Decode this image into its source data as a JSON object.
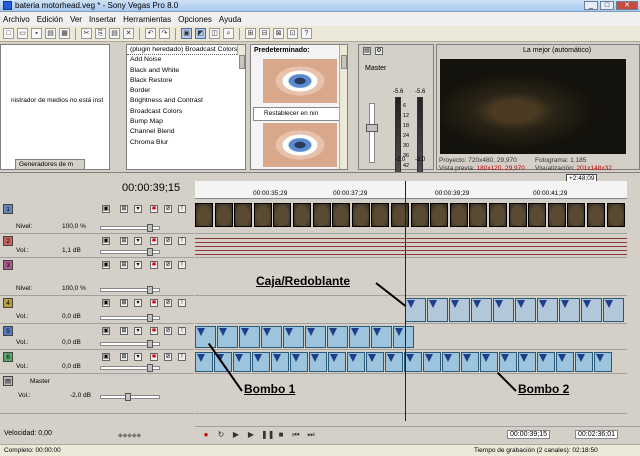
{
  "window": {
    "title": "bateria motorhead.veg * - Sony Vegas Pro 8.0",
    "min": "_",
    "max": "□",
    "close": "✕"
  },
  "menu": [
    "Archivo",
    "Edición",
    "Ver",
    "Insertar",
    "Herramientas",
    "Opciones",
    "Ayuda"
  ],
  "toolbar": {
    "icons": [
      "new-icon",
      "open-icon",
      "save-icon",
      "properties-icon",
      "render-icon",
      "cut-icon",
      "copy-icon",
      "paste-icon",
      "delete-icon",
      "undo-icon",
      "redo-icon",
      "normal-edit-icon",
      "envelope-edit-icon",
      "selection-edit-icon",
      "zoom-edit-icon",
      "snap-icon",
      "autoripple-icon",
      "lock-envelopes-icon",
      "ignore-grouping-icon",
      "help-icon"
    ],
    "glyphs": [
      "□",
      "▭",
      "▪",
      "▤",
      "▦",
      "✂",
      "⎘",
      "▤",
      "✕",
      "↶",
      "↷",
      "▣",
      "◩",
      "◫",
      "⌕",
      "⊞",
      "⊟",
      "⊠",
      "⊡",
      "?"
    ],
    "active": [
      11,
      12
    ]
  },
  "media_explorer": {
    "message": "nistrador de medios no está inst",
    "tab": "Generadores de m"
  },
  "fx_list": {
    "items": [
      "(plugin heredado) Broadcast Colors",
      "Add Noise",
      "Black and White",
      "Black Restore",
      "Border",
      "Brightness and Contrast",
      "Broadcast Colors",
      "Bump Map",
      "Channel Blend",
      "Chroma Blur"
    ],
    "selected": 0
  },
  "presets": {
    "title": "Predeterminado:",
    "reset_label": "Restablecer en nin"
  },
  "mixer": {
    "master_label": "Master",
    "peak_left": "-5.6",
    "peak_right": "-5.6",
    "scale": [
      "6",
      "12",
      "18",
      "24",
      "30",
      "36",
      "42",
      "48"
    ],
    "bottom_left": "-2.0",
    "bottom_right": "-2.0"
  },
  "preview": {
    "quality": "La mejor (automático)",
    "info": {
      "proyecto_label": "Proyecto:",
      "proyecto_value": "720x480, 29,970",
      "fotograma_label": "Fotograma:",
      "fotograma_value": "1.185",
      "vista_label": "Vista previa:",
      "vista_value": "180x120, 29,970",
      "visualizacion_label": "Visualización:",
      "visualizacion_value": "201x148x32"
    }
  },
  "timeline": {
    "timecode": "00:00:39;15",
    "marker": "+2:48;09",
    "ruler": [
      "00:00:35;29",
      "00:00:37;29",
      "00:00:39;29",
      "00:00:41;29"
    ],
    "tracks": [
      {
        "num": "1",
        "color": "#6b87b8",
        "type": "video",
        "level_label": "Nivel:",
        "level_value": "100,0 %"
      },
      {
        "num": "2",
        "color": "#c46060",
        "type": "audio",
        "level_label": "Vol.:",
        "level_value": "1,1 dB"
      },
      {
        "num": "3",
        "color": "#a85b8e",
        "type": "video",
        "level_label": "Nivel:",
        "level_value": "100,0 %"
      },
      {
        "num": "4",
        "color": "#b8a040",
        "type": "audio",
        "level_label": "Vol.:",
        "level_value": "0,0 dB"
      },
      {
        "num": "5",
        "color": "#5a7ac0",
        "type": "audio",
        "level_label": "Vol.:",
        "level_value": "0,0 dB"
      },
      {
        "num": "6",
        "color": "#5aa86a",
        "type": "audio",
        "level_label": "Vol.:",
        "level_value": "0,0 dB"
      }
    ],
    "master": {
      "label": "Master",
      "vol_label": "Vol.:",
      "vol_value": "-2,0 dB"
    },
    "velocity": "Velocidad: 0,00",
    "end_timecode_1": "00:00:39;15",
    "end_timecode_2": "00:02:36;01"
  },
  "annotations": {
    "caja": "Caja/Redoblante",
    "bombo1": "Bombo 1",
    "bombo2": "Bombo 2"
  },
  "status": {
    "left": "Completo: 00:00:00",
    "right": "Tiempo de grabación (2 canales): 02:18:50"
  }
}
